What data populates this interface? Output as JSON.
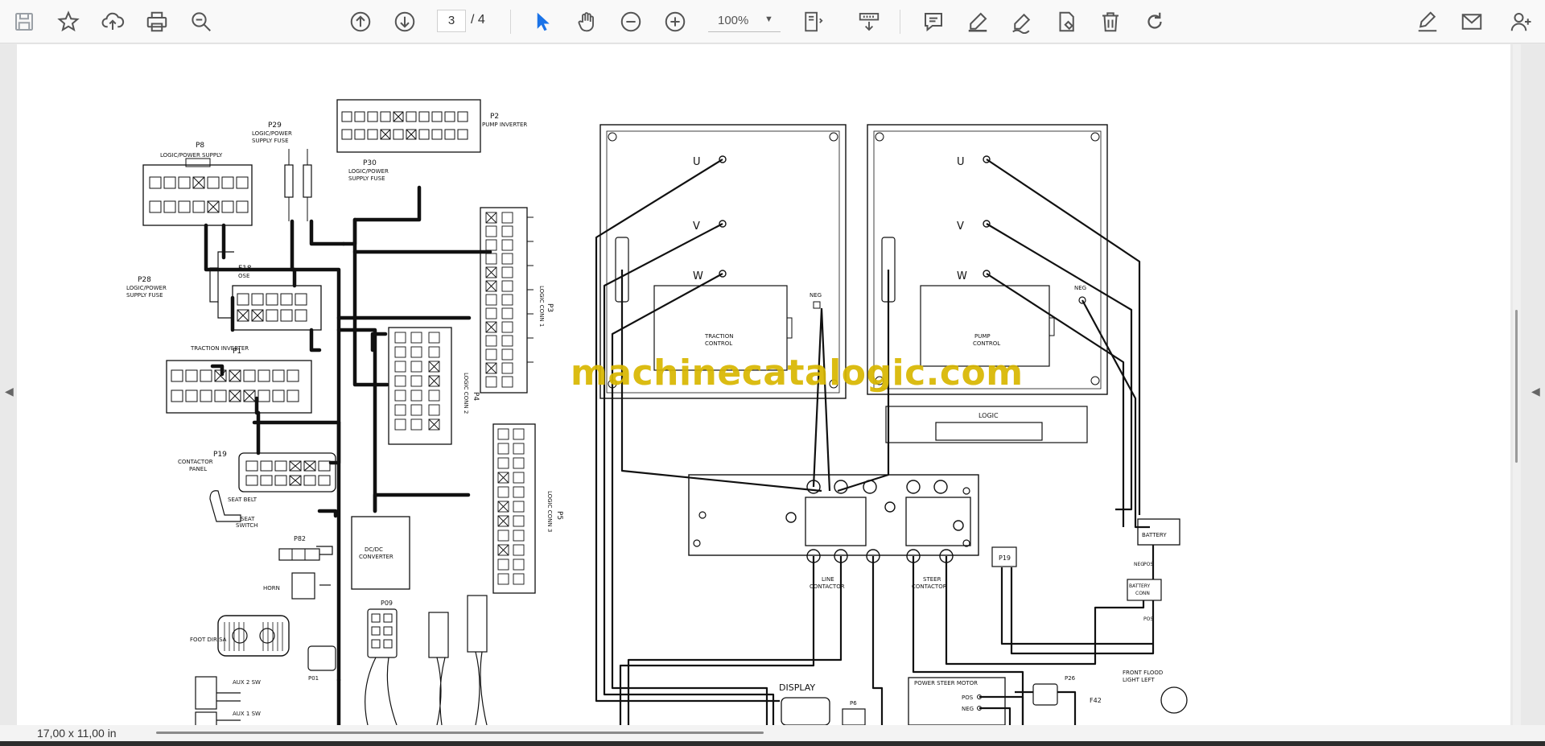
{
  "toolbar": {
    "page_current": "3",
    "page_total": "/ 4",
    "zoom": "100%",
    "icons": [
      "save-icon",
      "bookmark-star-icon",
      "upload-icon",
      "print-icon",
      "zoom-search-icon",
      "prev-page-icon",
      "next-page-icon",
      "select-cursor-icon",
      "hand-icon",
      "zoom-out-icon",
      "zoom-in-icon",
      "fit-page-icon",
      "scroll-mode-icon",
      "comment-icon",
      "highlight-pen-icon",
      "draw-icon",
      "stamp-icon",
      "trash-icon",
      "rotate-icon",
      "sign-icon",
      "email-icon",
      "add-user-icon"
    ]
  },
  "document": {
    "watermark": "machinecatalogic.com",
    "labels": {
      "p8": "P8",
      "p8_desc": "LOGIC/POWER SUPPLY",
      "p29": "P29",
      "p29_desc1": "LOGIC/POWER",
      "p29_desc2": "SUPPLY FUSE",
      "p2": "P2",
      "p2_desc": "PUMP INVERTER",
      "p30": "P30",
      "p30_desc1": "LOGIC/POWER",
      "p30_desc2": "SUPPLY FUSE",
      "p28": "P28",
      "p28_desc1": "LOGIC/POWER",
      "p28_desc2": "SUPPLY FUSE",
      "f18": "F18",
      "f18_desc": "OSE",
      "p1": "P1",
      "p1_desc": "TRACTION INVERTER",
      "p19": "P19",
      "p19_desc1": "CONTACTOR",
      "p19_desc2": "PANEL",
      "seat_belt": "SEAT BELT",
      "seat_switch1": "SEAT",
      "seat_switch2": "SWITCH",
      "p82": "P82",
      "horn": "HORN",
      "foot_dir": "FOOT DIR SA",
      "aux2": "AUX 2 SW",
      "aux1": "AUX 1 SW",
      "dcdc1": "DC/DC",
      "dcdc2": "CONVERTER",
      "p3": "P3",
      "p3_desc": "LOGIC CONN 1",
      "p4": "P4",
      "p4_desc": "LOGIC CONN 2",
      "p5": "P5",
      "p5_desc": "LOGIC CONN 3",
      "u": "U",
      "v": "V",
      "w": "W",
      "neg": "NEG",
      "traction_control1": "TRACTION",
      "traction_control2": "CONTROL",
      "pump_control1": "PUMP",
      "pump_control2": "CONTROL",
      "logic": "LOGIC",
      "line_contactor1": "LINE",
      "line_contactor2": "CONTACTOR",
      "steer_contactor1": "STEER",
      "steer_contactor2": "CONTACTOR",
      "p19b": "P19",
      "battery": "BATTERY",
      "battery_conn1": "BATTERY",
      "battery_conn2": "CONN",
      "pos": "POS",
      "display": "DISPLAY",
      "p6": "P6",
      "power_steer_motor": "POWER STEER MOTOR",
      "p26": "P26",
      "front_flood1": "FRONT FLOOD",
      "front_flood2": "LIGHT LEFT",
      "f42": "F42",
      "p01": "P01",
      "p09": "P09"
    }
  },
  "status": {
    "page_size": "17,00 x 11,00 in"
  }
}
